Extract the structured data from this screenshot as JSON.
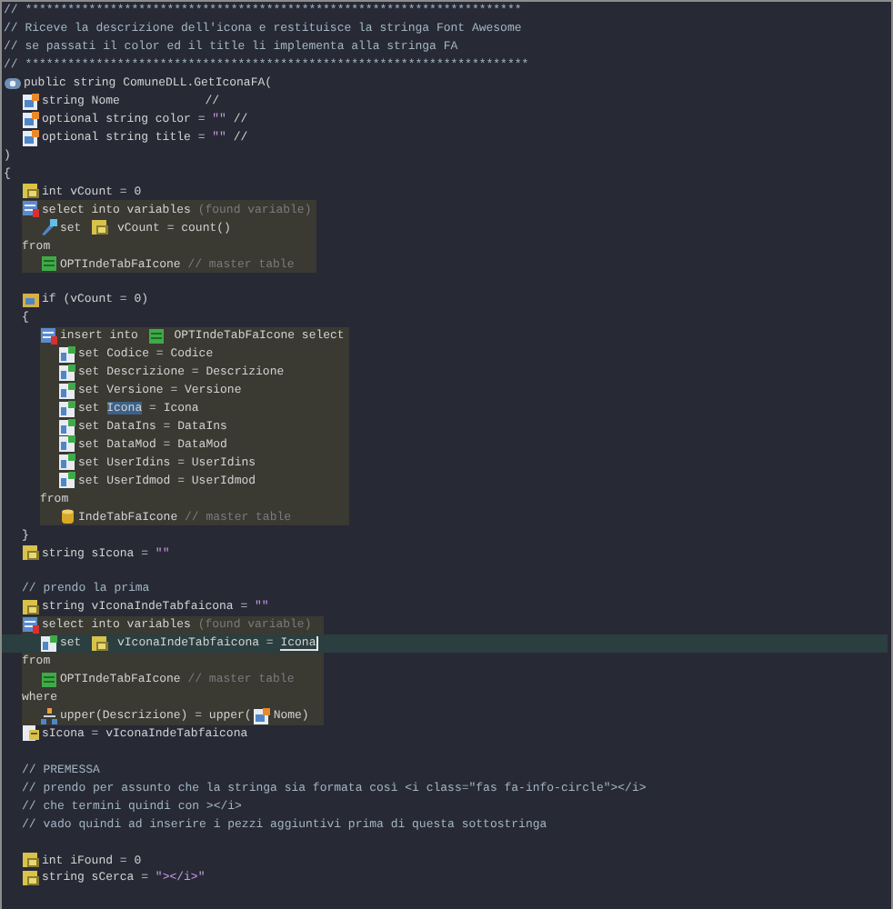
{
  "editor": {
    "lines": [
      {
        "kind": "comment",
        "segments": [
          {
            "kind": "text",
            "text": "// **********************************************************************"
          }
        ]
      },
      {
        "kind": "comment",
        "segments": [
          {
            "kind": "text",
            "text": "// Riceve la descrizione dell'icona e restituisce la stringa Font Awesome"
          }
        ]
      },
      {
        "kind": "comment",
        "segments": [
          {
            "kind": "text",
            "text": "// se passati il color ed il title li implementa alla stringa FA"
          }
        ]
      },
      {
        "kind": "comment",
        "segments": [
          {
            "kind": "text",
            "text": "// ***********************************************************************"
          }
        ]
      },
      {
        "kind": "function",
        "segments": [
          {
            "kind": "text",
            "text": "public string ComuneDLL.GetIconaFA("
          }
        ]
      },
      {
        "kind": "indent",
        "children": [
          {
            "kind": "param",
            "segments": [
              {
                "kind": "text",
                "text": "string Nome            //"
              }
            ]
          },
          {
            "kind": "param",
            "segments": [
              {
                "kind": "text",
                "text": "optional string color = "
              },
              {
                "kind": "string",
                "text": "\"\""
              },
              {
                "kind": "text",
                "text": " //"
              }
            ]
          },
          {
            "kind": "param",
            "segments": [
              {
                "kind": "text",
                "text": "optional string title = "
              },
              {
                "kind": "string",
                "text": "\"\""
              },
              {
                "kind": "text",
                "text": " //"
              }
            ]
          }
        ]
      },
      {
        "kind": "code",
        "segments": [
          {
            "kind": "text",
            "text": ")"
          }
        ]
      },
      {
        "kind": "code",
        "segments": [
          {
            "kind": "text",
            "text": "{"
          }
        ]
      },
      {
        "kind": "indent",
        "children": [
          {
            "kind": "variable",
            "segments": [
              {
                "kind": "text",
                "text": "int vCount = 0"
              }
            ]
          },
          {
            "kind": "block",
            "children": [
              {
                "kind": "select",
                "segments": [
                  {
                    "kind": "text",
                    "text": "select into variables "
                  },
                  {
                    "kind": "note",
                    "text": "(found variable)"
                  }
                ]
              },
              {
                "kind": "indent",
                "children": [
                  {
                    "kind": "set",
                    "segments": [
                      {
                        "kind": "text",
                        "text": "set "
                      },
                      {
                        "kind": "variable-icon"
                      },
                      {
                        "kind": "text",
                        "text": " vCount = count()"
                      }
                    ]
                  }
                ]
              },
              {
                "kind": "code",
                "segments": [
                  {
                    "kind": "text",
                    "text": "from"
                  }
                ]
              },
              {
                "kind": "indent",
                "children": [
                  {
                    "kind": "table",
                    "segments": [
                      {
                        "kind": "text",
                        "text": "OPTIndeTabFaIcone "
                      },
                      {
                        "kind": "note",
                        "text": "// master table"
                      }
                    ]
                  }
                ]
              }
            ]
          },
          {
            "kind": "blank"
          },
          {
            "kind": "condition",
            "segments": [
              {
                "kind": "text",
                "text": "if (vCount = 0)"
              }
            ]
          },
          {
            "kind": "code",
            "segments": [
              {
                "kind": "text",
                "text": "{"
              }
            ]
          },
          {
            "kind": "indent",
            "children": [
              {
                "kind": "block",
                "children": [
                  {
                    "kind": "insert",
                    "segments": [
                      {
                        "kind": "text",
                        "text": "insert into "
                      },
                      {
                        "kind": "table-icon"
                      },
                      {
                        "kind": "text",
                        "text": " OPTIndeTabFaIcone select"
                      }
                    ]
                  },
                  {
                    "kind": "indent",
                    "children": [
                      {
                        "kind": "column",
                        "segments": [
                          {
                            "kind": "text",
                            "text": "set Codice = Codice"
                          }
                        ]
                      },
                      {
                        "kind": "column",
                        "segments": [
                          {
                            "kind": "text",
                            "text": "set Descrizione = Descrizione"
                          }
                        ]
                      },
                      {
                        "kind": "column",
                        "segments": [
                          {
                            "kind": "text",
                            "text": "set Versione = Versione"
                          }
                        ]
                      },
                      {
                        "kind": "column",
                        "segments": [
                          {
                            "kind": "text",
                            "text": "set "
                          },
                          {
                            "kind": "selection",
                            "text": "Icona"
                          },
                          {
                            "kind": "text",
                            "text": " = Icona"
                          }
                        ]
                      },
                      {
                        "kind": "column",
                        "segments": [
                          {
                            "kind": "text",
                            "text": "set DataIns = DataIns"
                          }
                        ]
                      },
                      {
                        "kind": "column",
                        "segments": [
                          {
                            "kind": "text",
                            "text": "set DataMod = DataMod"
                          }
                        ]
                      },
                      {
                        "kind": "column",
                        "segments": [
                          {
                            "kind": "text",
                            "text": "set UserIdins = UserIdins"
                          }
                        ]
                      },
                      {
                        "kind": "column",
                        "segments": [
                          {
                            "kind": "text",
                            "text": "set UserIdmod = UserIdmod"
                          }
                        ]
                      }
                    ]
                  },
                  {
                    "kind": "code",
                    "segments": [
                      {
                        "kind": "text",
                        "text": "from"
                      }
                    ]
                  },
                  {
                    "kind": "indent",
                    "children": [
                      {
                        "kind": "source",
                        "segments": [
                          {
                            "kind": "text",
                            "text": "IndeTabFaIcone "
                          },
                          {
                            "kind": "note",
                            "text": "// master table"
                          }
                        ]
                      }
                    ]
                  }
                ]
              }
            ]
          },
          {
            "kind": "code",
            "segments": [
              {
                "kind": "text",
                "text": "}"
              }
            ]
          },
          {
            "kind": "variable",
            "segments": [
              {
                "kind": "text",
                "text": "string sIcona = "
              },
              {
                "kind": "string",
                "text": "\"\""
              }
            ]
          },
          {
            "kind": "blank"
          },
          {
            "kind": "comment",
            "segments": [
              {
                "kind": "text",
                "text": "// prendo la prima"
              }
            ]
          },
          {
            "kind": "variable",
            "segments": [
              {
                "kind": "text",
                "text": "string vIconaIndeTabfaicona = "
              },
              {
                "kind": "string",
                "text": "\"\""
              }
            ]
          },
          {
            "kind": "block",
            "children": [
              {
                "kind": "select",
                "segments": [
                  {
                    "kind": "text",
                    "text": "select into variables "
                  },
                  {
                    "kind": "note",
                    "text": "(found variable)"
                  }
                ]
              },
              {
                "kind": "indent",
                "children": [
                  {
                    "kind": "column",
                    "current": true,
                    "segments": [
                      {
                        "kind": "text",
                        "text": "set "
                      },
                      {
                        "kind": "variable-icon"
                      },
                      {
                        "kind": "text",
                        "text": " vIconaIndeTabfaicona = "
                      },
                      {
                        "kind": "underline",
                        "text": "Icona"
                      }
                    ]
                  }
                ]
              },
              {
                "kind": "code",
                "segments": [
                  {
                    "kind": "text",
                    "text": "from"
                  }
                ]
              },
              {
                "kind": "indent",
                "children": [
                  {
                    "kind": "table",
                    "segments": [
                      {
                        "kind": "text",
                        "text": "OPTIndeTabFaIcone "
                      },
                      {
                        "kind": "note",
                        "text": "// master table"
                      }
                    ]
                  }
                ]
              },
              {
                "kind": "code",
                "segments": [
                  {
                    "kind": "text",
                    "text": "where"
                  }
                ]
              },
              {
                "kind": "indent",
                "children": [
                  {
                    "kind": "where",
                    "segments": [
                      {
                        "kind": "text",
                        "text": "upper(Descrizione) = upper("
                      },
                      {
                        "kind": "param-icon"
                      },
                      {
                        "kind": "text",
                        "text": "Nome)"
                      }
                    ]
                  }
                ]
              }
            ]
          },
          {
            "kind": "assign",
            "segments": [
              {
                "kind": "text",
                "text": "sIcona = vIconaIndeTabfaicona"
              }
            ]
          },
          {
            "kind": "blank"
          },
          {
            "kind": "comment",
            "segments": [
              {
                "kind": "text",
                "text": "// PREMESSA"
              }
            ]
          },
          {
            "kind": "comment",
            "segments": [
              {
                "kind": "text",
                "text": "// prendo per assunto che la stringa sia formata così <i class=\"fas fa-info-circle\"></i>"
              }
            ]
          },
          {
            "kind": "comment",
            "segments": [
              {
                "kind": "text",
                "text": "// che termini quindi con ></i>"
              }
            ]
          },
          {
            "kind": "comment",
            "segments": [
              {
                "kind": "text",
                "text": "// vado quindi ad inserire i pezzi aggiuntivi prima di questa sottostringa"
              }
            ]
          },
          {
            "kind": "blank"
          },
          {
            "kind": "variable",
            "segments": [
              {
                "kind": "text",
                "text": "int iFound = 0"
              }
            ]
          },
          {
            "kind": "variable",
            "segments": [
              {
                "kind": "text",
                "text": "string sCerca = "
              },
              {
                "kind": "string",
                "text": "\"></i>\""
              }
            ]
          }
        ]
      }
    ]
  }
}
